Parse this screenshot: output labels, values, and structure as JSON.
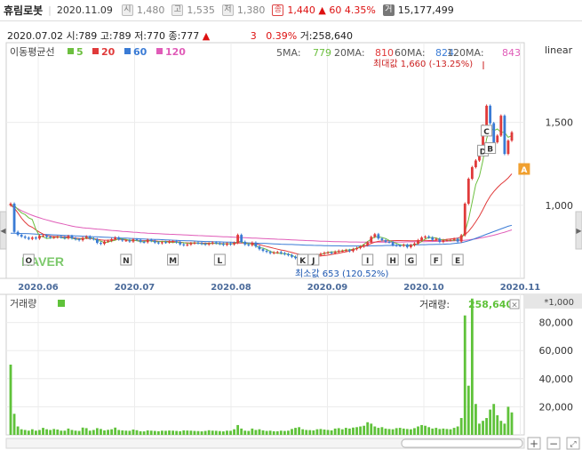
{
  "header": {
    "name": "휴림로봇",
    "date": "2020.11.09",
    "open_icon": "시",
    "open": "1,480",
    "high_icon": "고",
    "high": "1,535",
    "low_icon": "저",
    "low": "1,380",
    "close_icon": "종",
    "close": "1,440",
    "change_arrow": "▲",
    "change": "60",
    "change_pct": "4.35%",
    "volume_icon": "거",
    "volume": "15,177,499"
  },
  "info_bar": {
    "date": "2020.07.02",
    "open": "시:789",
    "high": "고:789",
    "low": "저:770",
    "close": "종:777",
    "arrow": "▲",
    "change": "3",
    "change_pct": "0.39%",
    "volume": "거:258,640"
  },
  "ma_legend": {
    "title": "이동평균선",
    "items": [
      {
        "label": "5",
        "color": "#6cbf3f"
      },
      {
        "label": "20",
        "color": "#e03a3a"
      },
      {
        "label": "60",
        "color": "#3a7bd5"
      },
      {
        "label": "120",
        "color": "#e05cb8"
      }
    ]
  },
  "ma_values": {
    "ma5_label": "5MA:",
    "ma5": "779",
    "ma20_label": "20MA:",
    "ma20": "810",
    "ma60_label": "60MA:",
    "ma60": "824",
    "ma120_label": "120MA:",
    "ma120": "843"
  },
  "scale_mode": "linear",
  "max_annotation": "최대값 1,660 (-13.25%)",
  "min_annotation": "최소값 653 (120.52%)",
  "watermark": "NAVER",
  "volume_panel": {
    "title": "거래량",
    "readout_label": "거래량:",
    "readout_value": "258,640",
    "unit": "*1,000"
  },
  "markers": [
    "O",
    "N",
    "M",
    "L",
    "K",
    "J",
    "I",
    "H",
    "G",
    "F",
    "E",
    "D",
    "C",
    "B",
    "A"
  ],
  "colors": {
    "up": "#e03a3a",
    "down": "#3a7bd5",
    "volume": "#5fc23a"
  },
  "chart_data": [
    {
      "type": "candlestick",
      "title": "",
      "x_tick_labels": [
        "2020.06",
        "2020.07",
        "2020.08",
        "2020.09",
        "2020.10",
        "2020.11"
      ],
      "y_tick_labels": [
        "1,500",
        "1,000"
      ],
      "ylim": [
        560,
        1980
      ],
      "close": [
        1010,
        840,
        822,
        812,
        805,
        798,
        806,
        800,
        816,
        818,
        810,
        806,
        808,
        810,
        808,
        802,
        815,
        802,
        796,
        790,
        804,
        812,
        800,
        796,
        774,
        768,
        782,
        786,
        796,
        806,
        795,
        788,
        789,
        782,
        795,
        792,
        780,
        778,
        792,
        786,
        776,
        772,
        778,
        777,
        781,
        783,
        777,
        765,
        760,
        764,
        772,
        774,
        772,
        768,
        764,
        770,
        776,
        772,
        768,
        762,
        770,
        765,
        774,
        822,
        780,
        764,
        760,
        775,
        752,
        736,
        726,
        720,
        712,
        716,
        718,
        712,
        706,
        700,
        690,
        682,
        673,
        680,
        690,
        688,
        690,
        700,
        708,
        714,
        716,
        712,
        720,
        726,
        726,
        730,
        724,
        736,
        743,
        752,
        760,
        776,
        810,
        826,
        800,
        790,
        780,
        778,
        760,
        758,
        757,
        762,
        748,
        760,
        770,
        790,
        806,
        812,
        806,
        792,
        798,
        780,
        790,
        790,
        792,
        798,
        782,
        820,
        1010,
        1160,
        1230,
        1270,
        1330,
        1480,
        1600,
        1495,
        1380,
        1420,
        1540,
        1310,
        1390,
        1440
      ],
      "ma5": [
        1000,
        1000,
        975,
        955,
        945,
        925,
        915,
        855,
        815,
        810,
        800,
        804,
        805,
        810,
        807,
        800,
        807,
        802,
        796,
        795,
        800,
        803,
        805,
        800,
        787,
        785,
        775,
        779,
        785,
        790,
        800,
        798,
        794,
        790,
        790,
        787,
        782,
        780,
        789,
        785,
        781,
        780,
        783,
        780,
        778,
        776,
        778,
        776,
        775,
        770,
        772,
        774,
        772,
        769,
        767,
        770,
        771,
        771,
        768,
        767,
        769,
        767,
        770,
        780,
        783,
        770,
        769,
        770,
        755,
        745,
        742,
        734,
        723,
        715,
        712,
        710,
        708,
        705,
        699,
        688,
        680,
        678,
        680,
        688,
        690,
        697,
        704,
        710,
        716,
        719,
        719,
        722,
        726,
        730,
        732,
        736,
        741,
        752,
        765,
        782,
        797,
        810,
        810,
        806,
        800,
        789,
        778,
        771,
        762,
        760,
        758,
        757,
        763,
        770,
        782,
        798,
        806,
        806,
        804,
        795,
        792,
        789,
        788,
        790,
        791,
        799,
        840,
        915,
        1020,
        1125,
        1175,
        1270,
        1400,
        1470,
        1450,
        1460,
        1440,
        1440,
        1410,
        1420
      ],
      "ma20": [
        1000,
        984,
        955,
        923,
        898,
        878,
        868,
        852,
        838,
        827,
        818,
        815,
        812,
        812,
        810,
        810,
        808,
        806,
        803,
        801,
        800,
        801,
        800,
        799,
        796,
        792,
        790,
        790,
        791,
        793,
        796,
        795,
        791,
        789,
        788,
        788,
        786,
        787,
        788,
        787,
        786,
        783,
        783,
        783,
        782,
        782,
        781,
        778,
        775,
        774,
        773,
        773,
        773,
        772,
        772,
        771,
        771,
        771,
        770,
        769,
        769,
        769,
        770,
        773,
        773,
        773,
        770,
        770,
        768,
        763,
        757,
        752,
        747,
        741,
        736,
        731,
        727,
        722,
        716,
        710,
        705,
        700,
        698,
        695,
        694,
        693,
        695,
        697,
        700,
        704,
        708,
        711,
        716,
        720,
        725,
        732,
        740,
        748,
        754,
        761,
        770,
        778,
        783,
        785,
        786,
        786,
        787,
        788,
        788,
        787,
        787,
        786,
        786,
        787,
        788,
        789,
        788,
        788,
        789,
        791,
        792,
        795,
        797,
        800,
        803,
        810,
        823,
        843,
        870,
        901,
        935,
        975,
        1018,
        1055,
        1083,
        1107,
        1128,
        1145,
        1165,
        1190
      ],
      "ma60": [
        832,
        832,
        831,
        830,
        830,
        829,
        828,
        827,
        826,
        825,
        824,
        823,
        822,
        821,
        820,
        819,
        818,
        817,
        816,
        815,
        814,
        813,
        812,
        811,
        810,
        809,
        808,
        807,
        806,
        805,
        804,
        803,
        802,
        801,
        800,
        799,
        798,
        797,
        796,
        795,
        794,
        794,
        793,
        792,
        791,
        790,
        789,
        788,
        787,
        786,
        786,
        785,
        784,
        783,
        782,
        782,
        781,
        780,
        780,
        779,
        778,
        778,
        777,
        776,
        775,
        775,
        774,
        773,
        772,
        771,
        771,
        770,
        769,
        768,
        767,
        766,
        765,
        764,
        764,
        763,
        762,
        761,
        760,
        760,
        759,
        758,
        758,
        757,
        757,
        756,
        756,
        756,
        755,
        755,
        755,
        755,
        755,
        755,
        755,
        755,
        756,
        756,
        757,
        757,
        758,
        758,
        759,
        759,
        760,
        760,
        761,
        761,
        762,
        762,
        763,
        763,
        764,
        764,
        765,
        765,
        766,
        767,
        768,
        770,
        772,
        775,
        780,
        786,
        793,
        801,
        809,
        817,
        826,
        834,
        842,
        850,
        858,
        866,
        874,
        880
      ],
      "ma120": [
        1000,
        990,
        980,
        968,
        958,
        948,
        940,
        932,
        925,
        918,
        912,
        906,
        900,
        895,
        890,
        885,
        880,
        875,
        871,
        868,
        865,
        863,
        861,
        859,
        857,
        855,
        853,
        851,
        849,
        847,
        845,
        843,
        842,
        840,
        838,
        837,
        835,
        834,
        832,
        831,
        830,
        829,
        828,
        827,
        826,
        825,
        824,
        823,
        822,
        821,
        820,
        819,
        818,
        817,
        816,
        815,
        814,
        813,
        812,
        811,
        810,
        809,
        808,
        807,
        806,
        805,
        804,
        803,
        802,
        801,
        800,
        799,
        798,
        797,
        796,
        795,
        794,
        793,
        792,
        791,
        790,
        789,
        788,
        787,
        786,
        785,
        784,
        784,
        783,
        782,
        781,
        781,
        780,
        780,
        779,
        779,
        779,
        778,
        778,
        778,
        778,
        778,
        778,
        778,
        778,
        778,
        779,
        779,
        779,
        779,
        780,
        780,
        780,
        780,
        781,
        781,
        782,
        782,
        783,
        783,
        784,
        784,
        785,
        786,
        787,
        788,
        790,
        792,
        795,
        798,
        802,
        806,
        810,
        815,
        820,
        826,
        832,
        838,
        845,
        852
      ]
    },
    {
      "type": "bar",
      "title": "거래량",
      "y_tick_labels": [
        "80,000",
        "60,000",
        "40,000",
        "20,000"
      ],
      "ylim": [
        0,
        100000
      ],
      "volume": [
        50000,
        15000,
        6000,
        4000,
        3500,
        3000,
        4000,
        3000,
        3500,
        5000,
        4000,
        3500,
        4200,
        3800,
        3000,
        3000,
        4500,
        3500,
        3000,
        2800,
        5200,
        4800,
        3000,
        3500,
        4800,
        4200,
        3200,
        3600,
        4000,
        5200,
        3500,
        3200,
        3000,
        2900,
        3800,
        3300,
        2600,
        2500,
        3200,
        3000,
        2800,
        2600,
        3000,
        2900,
        3100,
        3000,
        2800,
        2600,
        3200,
        3100,
        3000,
        2800,
        2700,
        2500,
        2800,
        3300,
        3000,
        2900,
        2700,
        2500,
        3000,
        2900,
        4000,
        7000,
        4500,
        3000,
        2800,
        4500,
        3500,
        4000,
        3200,
        2800,
        3000,
        2600,
        2600,
        3000,
        2800,
        3000,
        4200,
        5000,
        5500,
        4000,
        3500,
        3400,
        3200,
        4000,
        4200,
        3800,
        3500,
        3200,
        4500,
        4800,
        4000,
        5000,
        4500,
        5200,
        5500,
        6000,
        6500,
        9000,
        8000,
        6000,
        5000,
        5500,
        4500,
        4200,
        4000,
        4800,
        5000,
        4500,
        4200,
        4000,
        4800,
        6000,
        7000,
        6500,
        5500,
        4500,
        5000,
        4200,
        4500,
        4200,
        4000,
        5000,
        6000,
        12000,
        85000,
        35000,
        97000,
        22000,
        8000,
        10000,
        12000,
        18000,
        22000,
        14000,
        10000,
        8000,
        20000,
        16000
      ]
    }
  ]
}
